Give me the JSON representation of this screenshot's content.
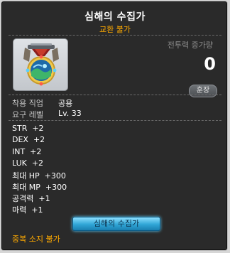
{
  "item": {
    "name": "심해의 수집가",
    "trade_status": "교환 불가",
    "icon": "deep-sea-collector-medal-icon"
  },
  "power": {
    "label": "전투력 증가량",
    "value": "0",
    "compare_label": "훈장"
  },
  "requirements": [
    {
      "label": "착용 직업",
      "value": "공용"
    },
    {
      "label": "요구 레벨",
      "value": "Lv. 33"
    }
  ],
  "stats": [
    "STR  +2",
    "DEX  +2",
    "INT  +2",
    "LUK  +2",
    "최대 HP  +300",
    "최대 MP  +300",
    "공격력  +1",
    "마력  +1"
  ],
  "set_badge": "심해의 수집가",
  "footer_note": "중복 소지 불가",
  "colors": {
    "background": "#2a2a2a",
    "accent_orange": "#ffaa00",
    "badge_blue": "#2fa5d6"
  }
}
